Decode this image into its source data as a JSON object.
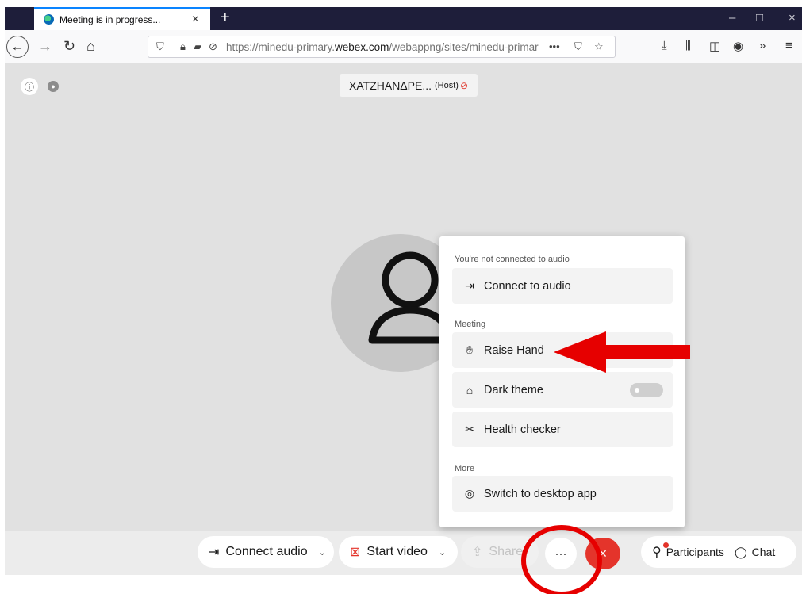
{
  "browser": {
    "tab_title": "Meeting is in progress...",
    "tab_close": "×",
    "new_tab": "+",
    "win_min": "–",
    "win_max": "□",
    "win_close": "×",
    "url_prefix": "https://minedu-primary.",
    "url_domain": "webex.com",
    "url_suffix": "/webappng/sites/minedu-primar",
    "url_more": "•••"
  },
  "stage": {
    "info_glyph": "ⓘ",
    "host_name": "ΧΑΤΖΗΑΝΔΡΕ...",
    "host_tag": "(Host)",
    "mic_glyph": "🎙"
  },
  "menu": {
    "section_audio": "You're not connected to audio",
    "connect_audio": "Connect to audio",
    "section_meeting": "Meeting",
    "raise_hand": "Raise Hand",
    "dark_theme": "Dark theme",
    "dark_theme_on": false,
    "health_checker": "Health checker",
    "section_more": "More",
    "switch_desktop": "Switch to desktop app"
  },
  "toolbar": {
    "connect_audio": "Connect audio",
    "start_video": "Start video",
    "share": "Share",
    "more": "···",
    "end": "×",
    "participants": "Participants",
    "chat": "Chat"
  },
  "colors": {
    "annotation_red": "#e60000",
    "end_red": "#e4342b",
    "tab_bg": "#1e1e3a"
  }
}
